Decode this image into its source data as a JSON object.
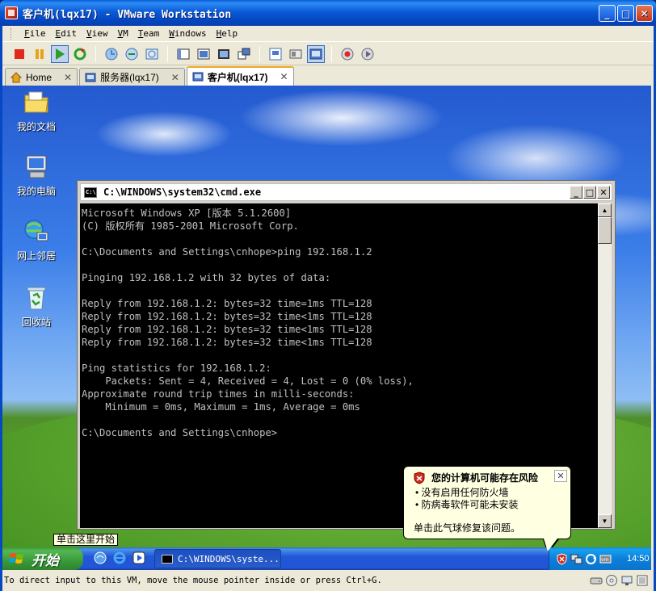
{
  "window": {
    "title": "客户机(lqx17) - VMware Workstation",
    "controls": {
      "minimize": "_",
      "maximize": "□",
      "close": "✕"
    }
  },
  "menu": [
    "File",
    "Edit",
    "View",
    "VM",
    "Team",
    "Windows",
    "Help"
  ],
  "tabs": [
    {
      "label": "Home",
      "icon": "home-icon"
    },
    {
      "label": "服务器(lqx17)",
      "icon": "vm-icon"
    },
    {
      "label": "客户机(lqx17)",
      "icon": "vm-icon",
      "active": true
    }
  ],
  "desktop": {
    "icons": [
      {
        "label": "我的文档",
        "icon": "my-documents-icon"
      },
      {
        "label": "我的电脑",
        "icon": "my-computer-icon"
      },
      {
        "label": "网上邻居",
        "icon": "network-icon"
      },
      {
        "label": "回收站",
        "icon": "recycle-bin-icon"
      }
    ]
  },
  "cmd": {
    "title": "C:\\WINDOWS\\system32\\cmd.exe",
    "icon_text": "C:\\",
    "lines": [
      "Microsoft Windows XP [版本 5.1.2600]",
      "(C) 版权所有 1985-2001 Microsoft Corp.",
      "",
      "C:\\Documents and Settings\\cnhope>ping 192.168.1.2",
      "",
      "Pinging 192.168.1.2 with 32 bytes of data:",
      "",
      "Reply from 192.168.1.2: bytes=32 time=1ms TTL=128",
      "Reply from 192.168.1.2: bytes=32 time<1ms TTL=128",
      "Reply from 192.168.1.2: bytes=32 time<1ms TTL=128",
      "Reply from 192.168.1.2: bytes=32 time<1ms TTL=128",
      "",
      "Ping statistics for 192.168.1.2:",
      "    Packets: Sent = 4, Received = 4, Lost = 0 (0% loss),",
      "Approximate round trip times in milli-seconds:",
      "    Minimum = 0ms, Maximum = 1ms, Average = 0ms",
      "",
      "C:\\Documents and Settings\\cnhope>"
    ]
  },
  "balloon": {
    "title": "您的计算机可能存在风险",
    "items": [
      "没有启用任何防火墙",
      "防病毒软件可能未安装"
    ],
    "footer": "单击此气球修复该问题。",
    "close": "✕"
  },
  "start_tooltip": "单击这里开始",
  "taskbar": {
    "start_label": "开始",
    "task_item": "C:\\WINDOWS\\syste...",
    "clock": "14:50"
  },
  "status": {
    "text": "To direct input to this VM, move the mouse pointer inside or press Ctrl+G."
  },
  "colors": {
    "title_blue": "#0548c4",
    "taskbar_blue": "#2157d7",
    "start_green": "#3a9a3a",
    "console_bg": "#000000",
    "console_fg": "#c0c0c0",
    "balloon_bg": "#ffffe1"
  }
}
